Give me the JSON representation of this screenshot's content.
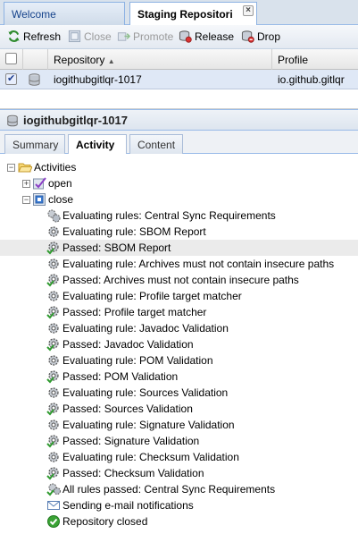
{
  "tabs": {
    "welcome": "Welcome",
    "staging": "Staging Repositori",
    "close_glyph": "×"
  },
  "toolbar": {
    "refresh": "Refresh",
    "close": "Close",
    "promote": "Promote",
    "release": "Release",
    "drop": "Drop"
  },
  "grid": {
    "columns": {
      "repository": "Repository",
      "sort_indicator": "▲",
      "profile": "Profile"
    },
    "row": {
      "repository": "iogithubgitlqr-1017",
      "profile": "io.github.gitlqr",
      "checked": true
    }
  },
  "detail": {
    "title": "iogithubgitlqr-1017",
    "tabs": {
      "summary": "Summary",
      "activity": "Activity",
      "content": "Content"
    }
  },
  "tree": {
    "root": "Activities",
    "open": "open",
    "close": "close",
    "events": [
      {
        "icon": "gears-icon",
        "text": "Evaluating rules: Central Sync Requirements"
      },
      {
        "icon": "gear-icon",
        "text": "Evaluating rule: SBOM Report"
      },
      {
        "icon": "gear-passed-icon",
        "text": "Passed: SBOM Report"
      },
      {
        "icon": "gear-icon",
        "text": "Evaluating rule: Archives must not contain insecure paths"
      },
      {
        "icon": "gear-passed-icon",
        "text": "Passed: Archives must not contain insecure paths"
      },
      {
        "icon": "gear-icon",
        "text": "Evaluating rule: Profile target matcher"
      },
      {
        "icon": "gear-passed-icon",
        "text": "Passed: Profile target matcher"
      },
      {
        "icon": "gear-icon",
        "text": "Evaluating rule: Javadoc Validation"
      },
      {
        "icon": "gear-passed-icon",
        "text": "Passed: Javadoc Validation"
      },
      {
        "icon": "gear-icon",
        "text": "Evaluating rule: POM Validation"
      },
      {
        "icon": "gear-passed-icon",
        "text": "Passed: POM Validation"
      },
      {
        "icon": "gear-icon",
        "text": "Evaluating rule: Sources Validation"
      },
      {
        "icon": "gear-passed-icon",
        "text": "Passed: Sources Validation"
      },
      {
        "icon": "gear-icon",
        "text": "Evaluating rule: Signature Validation"
      },
      {
        "icon": "gear-passed-icon",
        "text": "Passed: Signature Validation"
      },
      {
        "icon": "gear-icon",
        "text": "Evaluating rule: Checksum Validation"
      },
      {
        "icon": "gear-passed-icon",
        "text": "Passed: Checksum Validation"
      },
      {
        "icon": "gears-passed-icon",
        "text": "All rules passed: Central Sync Requirements"
      },
      {
        "icon": "email-icon",
        "text": "Sending e-mail notifications"
      },
      {
        "icon": "check-circle-icon",
        "text": "Repository closed"
      }
    ]
  },
  "colors": {
    "accent": "#15428b",
    "selected_row": "#dfe8f6",
    "passed_green": "#3aa335",
    "highlight_row": "#ebebeb"
  }
}
